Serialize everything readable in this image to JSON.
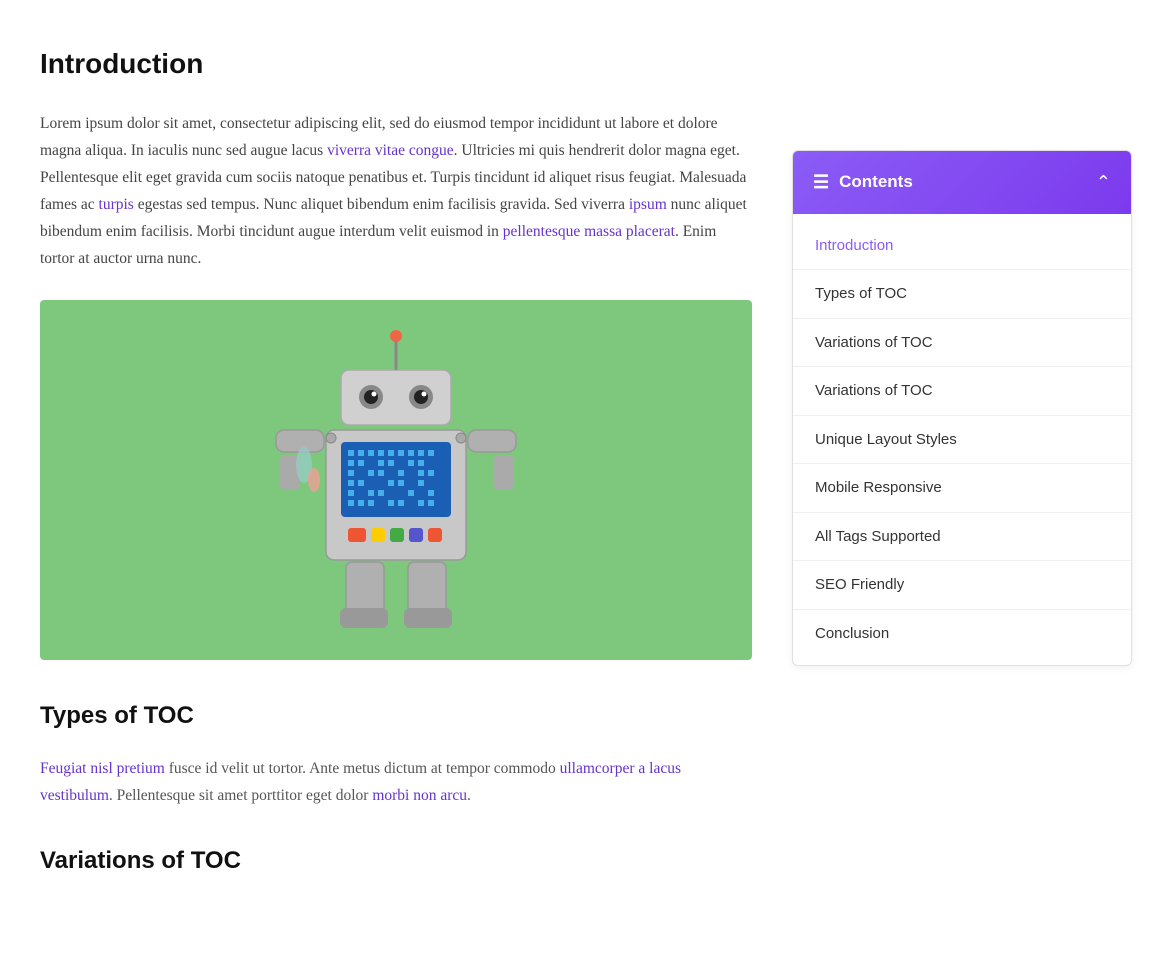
{
  "page": {
    "title": "Introduction"
  },
  "article": {
    "heading": "Introduction",
    "body_paragraphs": [
      "Lorem ipsum dolor sit amet, consectetur adipiscing elit, sed do eiusmod tempor incididunt ut labore et dolore magna aliqua. In iaculis nunc sed augue lacus viverra vitae congue. Ultricies mi quis hendrerit dolor magna eget. Pellentesque elit eget gravida cum sociis natoque penatibus et. Turpis tincidunt id aliquet risus feugiat. Malesuada fames ac turpis egestas sed tempus. Nunc aliquet bibendum enim facilisis gravida. Sed viverra ipsum nunc aliquet bibendum enim facilisis. Morbi tincidunt augue interdum velit euismod in pellentesque massa placerat. Enim tortor at auctor urna nunc."
    ],
    "section1_heading": "Types of TOC",
    "section1_body": "Feugiat nisl pretium fusce id velit ut tortor. Ante metus dictum at tempor commodo ullamcorper a lacus vestibulum. Pellentesque sit amet porttitor eget dolor morbi non arcu.",
    "section2_heading": "Variations of TOC"
  },
  "toc": {
    "header_label": "Contents",
    "items": [
      {
        "label": "Introduction",
        "active": true
      },
      {
        "label": "Types of TOC",
        "active": false
      },
      {
        "label": "Variations of TOC",
        "active": false
      },
      {
        "label": "Variations of TOC",
        "active": false
      },
      {
        "label": "Unique Layout Styles",
        "active": false
      },
      {
        "label": "Mobile Responsive",
        "active": false
      },
      {
        "label": "All Tags Supported",
        "active": false
      },
      {
        "label": "SEO Friendly",
        "active": false
      },
      {
        "label": "Conclusion",
        "active": false
      }
    ]
  },
  "colors": {
    "toc_accent": "#8b5cf6",
    "toc_header_bg": "#7c3aed",
    "active_link": "#8b5cf6",
    "image_bg": "#7ec87e"
  }
}
